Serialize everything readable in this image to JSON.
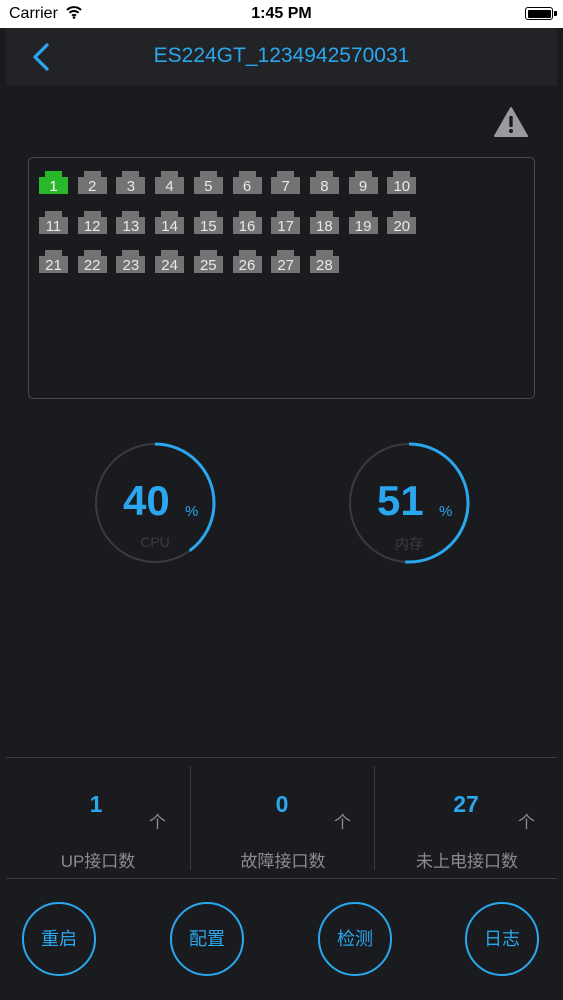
{
  "status_bar": {
    "carrier": "Carrier",
    "time": "1:45 PM"
  },
  "nav": {
    "title": "ES224GT_1234942570031"
  },
  "ports": [
    {
      "label": "1",
      "active": true
    },
    {
      "label": "2",
      "active": false
    },
    {
      "label": "3",
      "active": false
    },
    {
      "label": "4",
      "active": false
    },
    {
      "label": "5",
      "active": false
    },
    {
      "label": "6",
      "active": false
    },
    {
      "label": "7",
      "active": false
    },
    {
      "label": "8",
      "active": false
    },
    {
      "label": "9",
      "active": false
    },
    {
      "label": "10",
      "active": false
    },
    {
      "label": "11",
      "active": false
    },
    {
      "label": "12",
      "active": false
    },
    {
      "label": "13",
      "active": false
    },
    {
      "label": "14",
      "active": false
    },
    {
      "label": "15",
      "active": false
    },
    {
      "label": "16",
      "active": false
    },
    {
      "label": "17",
      "active": false
    },
    {
      "label": "18",
      "active": false
    },
    {
      "label": "19",
      "active": false
    },
    {
      "label": "20",
      "active": false
    },
    {
      "label": "21",
      "active": false
    },
    {
      "label": "22",
      "active": false
    },
    {
      "label": "23",
      "active": false
    },
    {
      "label": "24",
      "active": false
    },
    {
      "label": "25",
      "active": false
    },
    {
      "label": "26",
      "active": false
    },
    {
      "label": "27",
      "active": false
    },
    {
      "label": "28",
      "active": false
    }
  ],
  "gauges": {
    "cpu": {
      "value": "40",
      "unit": "%",
      "label": "CPU",
      "fraction": 0.4
    },
    "memory": {
      "value": "51",
      "unit": "%",
      "label": "内存",
      "fraction": 0.51
    }
  },
  "stats": [
    {
      "value": "1",
      "unit": "个",
      "label": "UP接口数"
    },
    {
      "value": "0",
      "unit": "个",
      "label": "故障接口数"
    },
    {
      "value": "27",
      "unit": "个",
      "label": "未上电接口数"
    }
  ],
  "actions": {
    "restart": "重启",
    "config": "配置",
    "detect": "检测",
    "log": "日志"
  },
  "colors": {
    "accent": "#2aa7ee",
    "port_active": "#29b829",
    "port_inactive": "#737373",
    "background": "#1a1b1f"
  }
}
